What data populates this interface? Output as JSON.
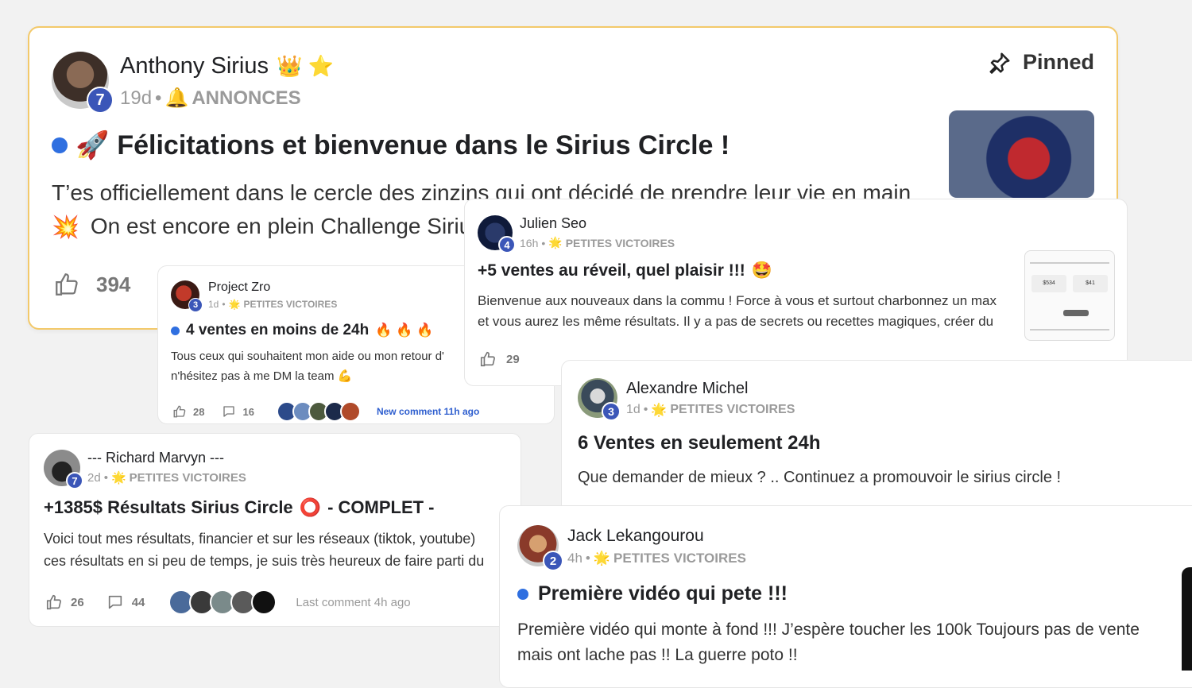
{
  "posts": {
    "anthony": {
      "author": "Anthony Sirius",
      "badges": "👑 ⭐",
      "level": "7",
      "time": "19d",
      "category_emoji": "🔔",
      "category": "ANNONCES",
      "pinned_label": "Pinned",
      "title_emoji": "🚀",
      "title": "Félicitations et bienvenue dans le Sirius Circle !",
      "line1": "T’es officiellement dans le cercle des zinzins qui ont décidé de prendre leur vie en main",
      "line2_emoji": "💥",
      "line2": "On est encore en plein Challenge Sirius",
      "likes": "394"
    },
    "project": {
      "author": "Project Zro",
      "level": "3",
      "time": "1d",
      "category_emoji": "🌟",
      "category": "PETITES VICTOIRES",
      "title": "4 ventes en moins de 24h",
      "title_emojis": "🔥 🔥 🔥",
      "line1": "Tous ceux qui souhaitent mon aide ou mon retour d'",
      "line2": "n'hésitez pas à me DM la team 💪",
      "likes": "28",
      "comments": "16",
      "activity": "New comment 11h ago"
    },
    "julien": {
      "author": "Julien Seo",
      "level": "4",
      "time": "16h",
      "category_emoji": "🌟",
      "category": "PETITES VICTOIRES",
      "title": "+5 ventes au réveil, quel plaisir !!!",
      "title_emoji": "🤩",
      "line1": "Bienvenue aux nouveaux dans la commu ! Force à vous et surtout charbonnez un max",
      "line2": "et vous aurez les même résultats. Il y a pas de secrets ou recettes magiques, créer du",
      "likes": "29",
      "thumb_value1": "$534",
      "thumb_value2": "$41"
    },
    "alexandre": {
      "author": "Alexandre Michel",
      "level": "3",
      "time": "1d",
      "category_emoji": "🌟",
      "category": "PETITES VICTOIRES",
      "title": "6 Ventes en seulement 24h",
      "line1": "Que demander de mieux ? .. Continuez a promouvoir le sirius circle !"
    },
    "richard": {
      "author": "--- Richard Marvyn ---",
      "level": "7",
      "time": "2d",
      "category_emoji": "🌟",
      "category": "PETITES VICTOIRES",
      "title": "+1385$ Résultats Sirius Circle",
      "title_emoji": "⭕",
      "title_suffix": "- COMPLET -",
      "line1": "Voici tout mes résultats, financier et sur les réseaux (tiktok, youtube)",
      "line2": "ces résultats en si peu de temps, je suis très heureux de faire parti du",
      "likes": "26",
      "comments": "44",
      "activity": "Last comment 4h ago"
    },
    "jack": {
      "author": "Jack Lekangourou",
      "level": "2",
      "time": "4h",
      "category_emoji": "🌟",
      "category": "PETITES VICTOIRES",
      "title": "Première vidéo qui pete !!!",
      "line1": "Première vidéo qui monte à fond !!! J’espère toucher les 100k Toujours pas de vente",
      "line2": "mais ont lache pas !! La guerre poto !!"
    }
  },
  "colors": {
    "accent_blue": "#2f6fe0",
    "level_badge": "#3b56b8",
    "pinned_border": "#f3c96a",
    "new_comment": "#2f5fcf"
  }
}
